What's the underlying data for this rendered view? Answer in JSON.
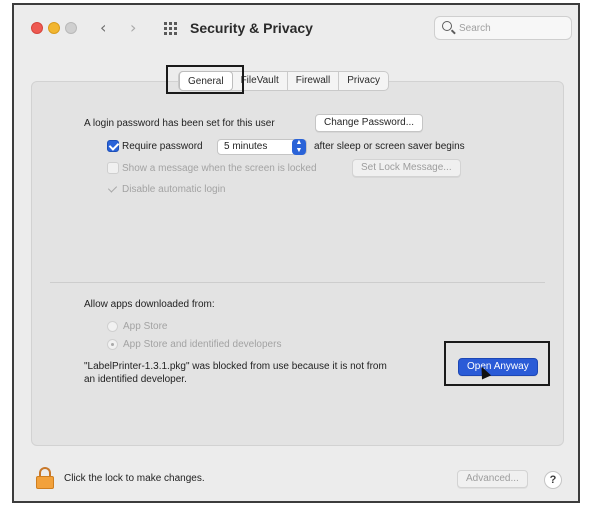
{
  "window": {
    "title": "Security & Privacy",
    "search_placeholder": "Search"
  },
  "tabs": [
    {
      "label": "General",
      "active": true
    },
    {
      "label": "FileVault",
      "active": false
    },
    {
      "label": "Firewall",
      "active": false
    },
    {
      "label": "Privacy",
      "active": false
    }
  ],
  "general": {
    "login_password_text": "A login password has been set for this user",
    "change_password_label": "Change Password...",
    "require_password_label": "Require password",
    "require_password_value": "5 minutes",
    "after_sleep_text": "after sleep or screen saver begins",
    "show_message_label": "Show a message when the screen is locked",
    "set_lock_message_label": "Set Lock Message...",
    "disable_auto_login_label": "Disable automatic login",
    "allow_apps_heading": "Allow apps downloaded from:",
    "option_app_store": "App Store",
    "option_app_store_identified": "App Store and identified developers",
    "blocked_message_line1": "\"LabelPrinter-1.3.1.pkg\" was blocked from use because it is not from",
    "blocked_message_line2": "an identified developer.",
    "open_anyway_label": "Open Anyway"
  },
  "footer": {
    "lock_text": "Click the lock to make changes.",
    "advanced_label": "Advanced...",
    "help_label": "?"
  },
  "colors": {
    "accent": "#2a63d8",
    "close": "#ee5a52",
    "minimize": "#f2b630",
    "lock": "#f2a13b"
  }
}
